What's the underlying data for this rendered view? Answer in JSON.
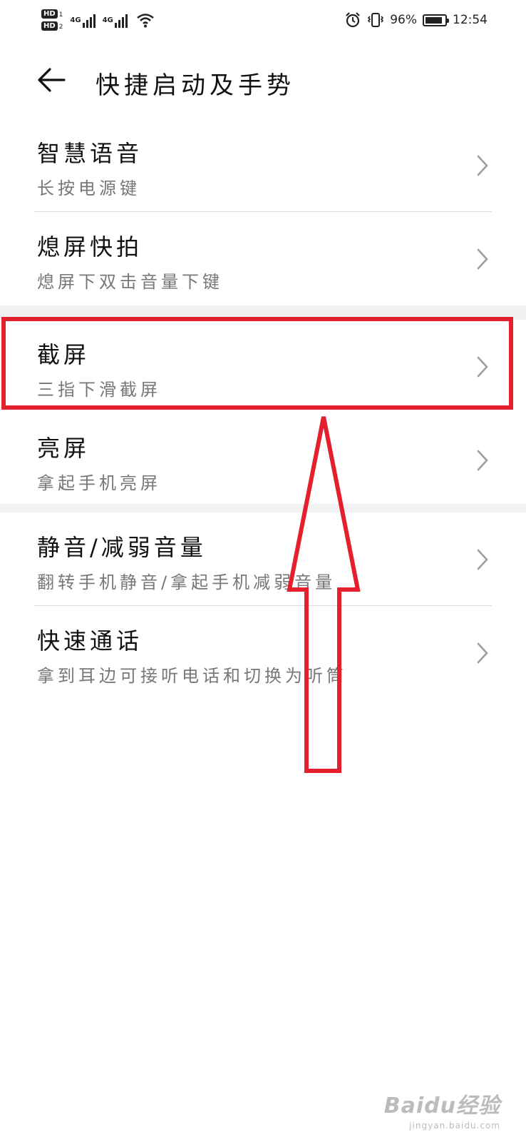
{
  "status_bar": {
    "sim1": "HD",
    "sim1_sub": "1",
    "sim2": "HD",
    "sim2_sub": "2",
    "net1": "4G",
    "net2": "4G",
    "battery_text": "96%",
    "battery_level": 0.96,
    "time": "12:54",
    "icons": [
      "alarm-icon",
      "vibrate-icon",
      "wifi-icon",
      "signal-icon",
      "battery-icon"
    ]
  },
  "header": {
    "title": "快捷启动及手势",
    "back_icon": "back-arrow-icon"
  },
  "groups": [
    {
      "items": [
        {
          "title": "智慧语音",
          "subtitle": "长按电源键"
        },
        {
          "title": "熄屏快拍",
          "subtitle": "熄屏下双击音量下键"
        }
      ]
    },
    {
      "items": [
        {
          "title": "截屏",
          "subtitle": "三指下滑截屏"
        },
        {
          "title": "亮屏",
          "subtitle": "拿起手机亮屏"
        }
      ]
    },
    {
      "items": [
        {
          "title": "静音/减弱音量",
          "subtitle": "翻转手机静音/拿起手机减弱音量"
        },
        {
          "title": "快速通话",
          "subtitle": "拿到耳边可接听电话和切换为听筒"
        }
      ]
    }
  ],
  "annotation": {
    "highlight_color": "#e5202e",
    "highlighted_item": "截屏"
  },
  "watermark": {
    "logo": "Baidu经验",
    "url": "jingyan.baidu.com"
  },
  "colors": {
    "background": "#ffffff",
    "group_gap": "#f1f1f1",
    "title_text": "#111111",
    "subtitle_text": "#777777",
    "chevron": "#9e9e9e",
    "annotation_red": "#e5202e"
  }
}
